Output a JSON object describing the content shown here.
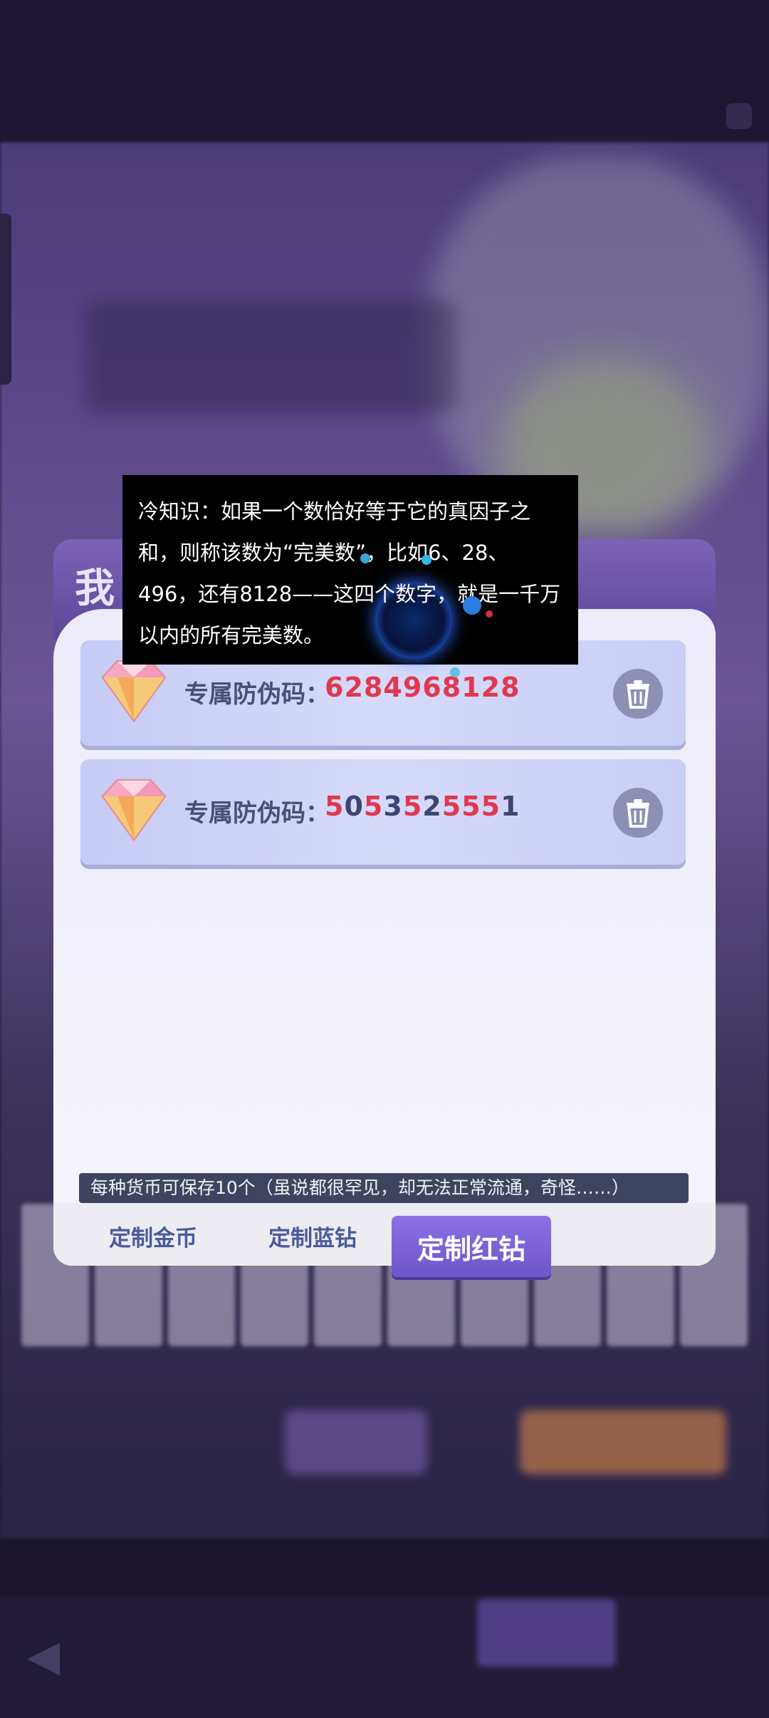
{
  "panel": {
    "title": "我"
  },
  "codes": [
    {
      "label": "专属防伪码：",
      "value": "6284968128",
      "value_digits": [
        "6",
        "2",
        "8",
        "4",
        "9",
        "6",
        "8",
        "1",
        "2",
        "8"
      ],
      "digit_colors": [
        "#e0384f",
        "#e0384f",
        "#e0384f",
        "#e0384f",
        "#e0384f",
        "#e0384f",
        "#e0384f",
        "#e0384f",
        "#e0384f",
        "#e0384f"
      ],
      "delete_icon": "trash-icon",
      "gem_icon": "gem-icon"
    },
    {
      "label": "专属防伪码：",
      "value": "5053525551",
      "value_digits": [
        "5",
        "0",
        "5",
        "3",
        "5",
        "2",
        "5",
        "5",
        "5",
        "1"
      ],
      "digit_colors": [
        "#e0384f",
        "#3e4670",
        "#e0384f",
        "#3e4670",
        "#e0384f",
        "#3e4670",
        "#e0384f",
        "#e0384f",
        "#e0384f",
        "#3e4670"
      ],
      "delete_icon": "trash-icon",
      "gem_icon": "gem-icon"
    }
  ],
  "notice": "每种货币可保存10个（虽说都很罕见，却无法正常流通，奇怪……）",
  "tabs": [
    {
      "label": "定制金币",
      "active": false
    },
    {
      "label": "定制蓝钻",
      "active": false
    },
    {
      "label": "定制红钻",
      "active": true
    }
  ],
  "tip": {
    "text": "冷知识：如果一个数恰好等于它的真因子之和，则称该数为“完美数”，比如6、28、496，还有8128——这四个数字，就是一千万以内的所有完美数。"
  },
  "colors": {
    "accent": "#7b63b8",
    "code_red": "#e0384f",
    "code_dark": "#3e4670",
    "tab_text": "#4a5a9c"
  }
}
